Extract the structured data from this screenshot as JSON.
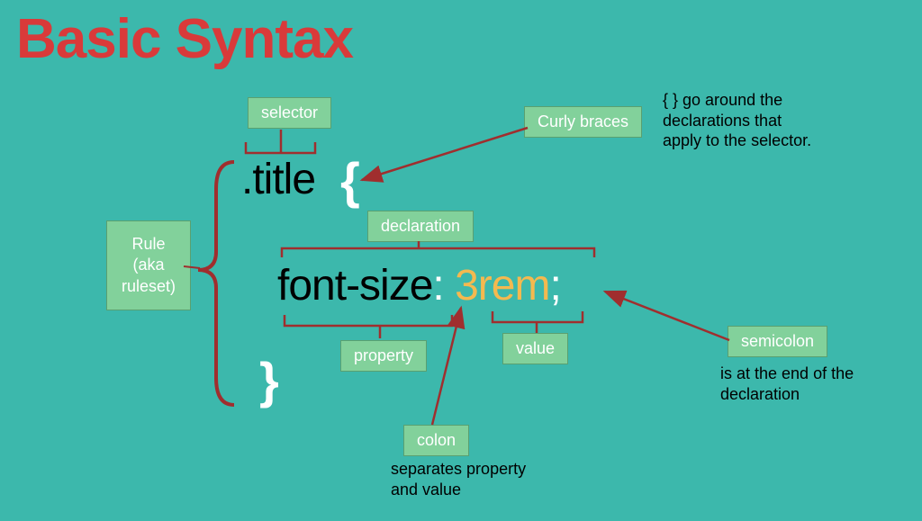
{
  "title": "Basic Syntax",
  "labels": {
    "selector": "selector",
    "curly_braces": "Curly braces",
    "declaration": "declaration",
    "rule": "Rule\n(aka\nruleset)",
    "property": "property",
    "value": "value",
    "semicolon": "semicolon",
    "colon": "colon"
  },
  "descriptions": {
    "curly_braces": "{ } go around the\ndeclarations that\napply to the selector.",
    "semicolon": "is at the end of the\ndeclaration",
    "colon": "separates property\nand value"
  },
  "code": {
    "selector": ".title",
    "open_brace": "{",
    "close_brace": "}",
    "property": "font-size",
    "colon": ":",
    "value": " 3rem",
    "semicolon": ";"
  },
  "colors": {
    "background": "#3cb8ac",
    "title": "#d93a3a",
    "label_bg": "#82d19b",
    "label_border": "#5aa070",
    "white": "#ffffff",
    "value": "#f4b94f",
    "bracket": "#a02e2e"
  }
}
